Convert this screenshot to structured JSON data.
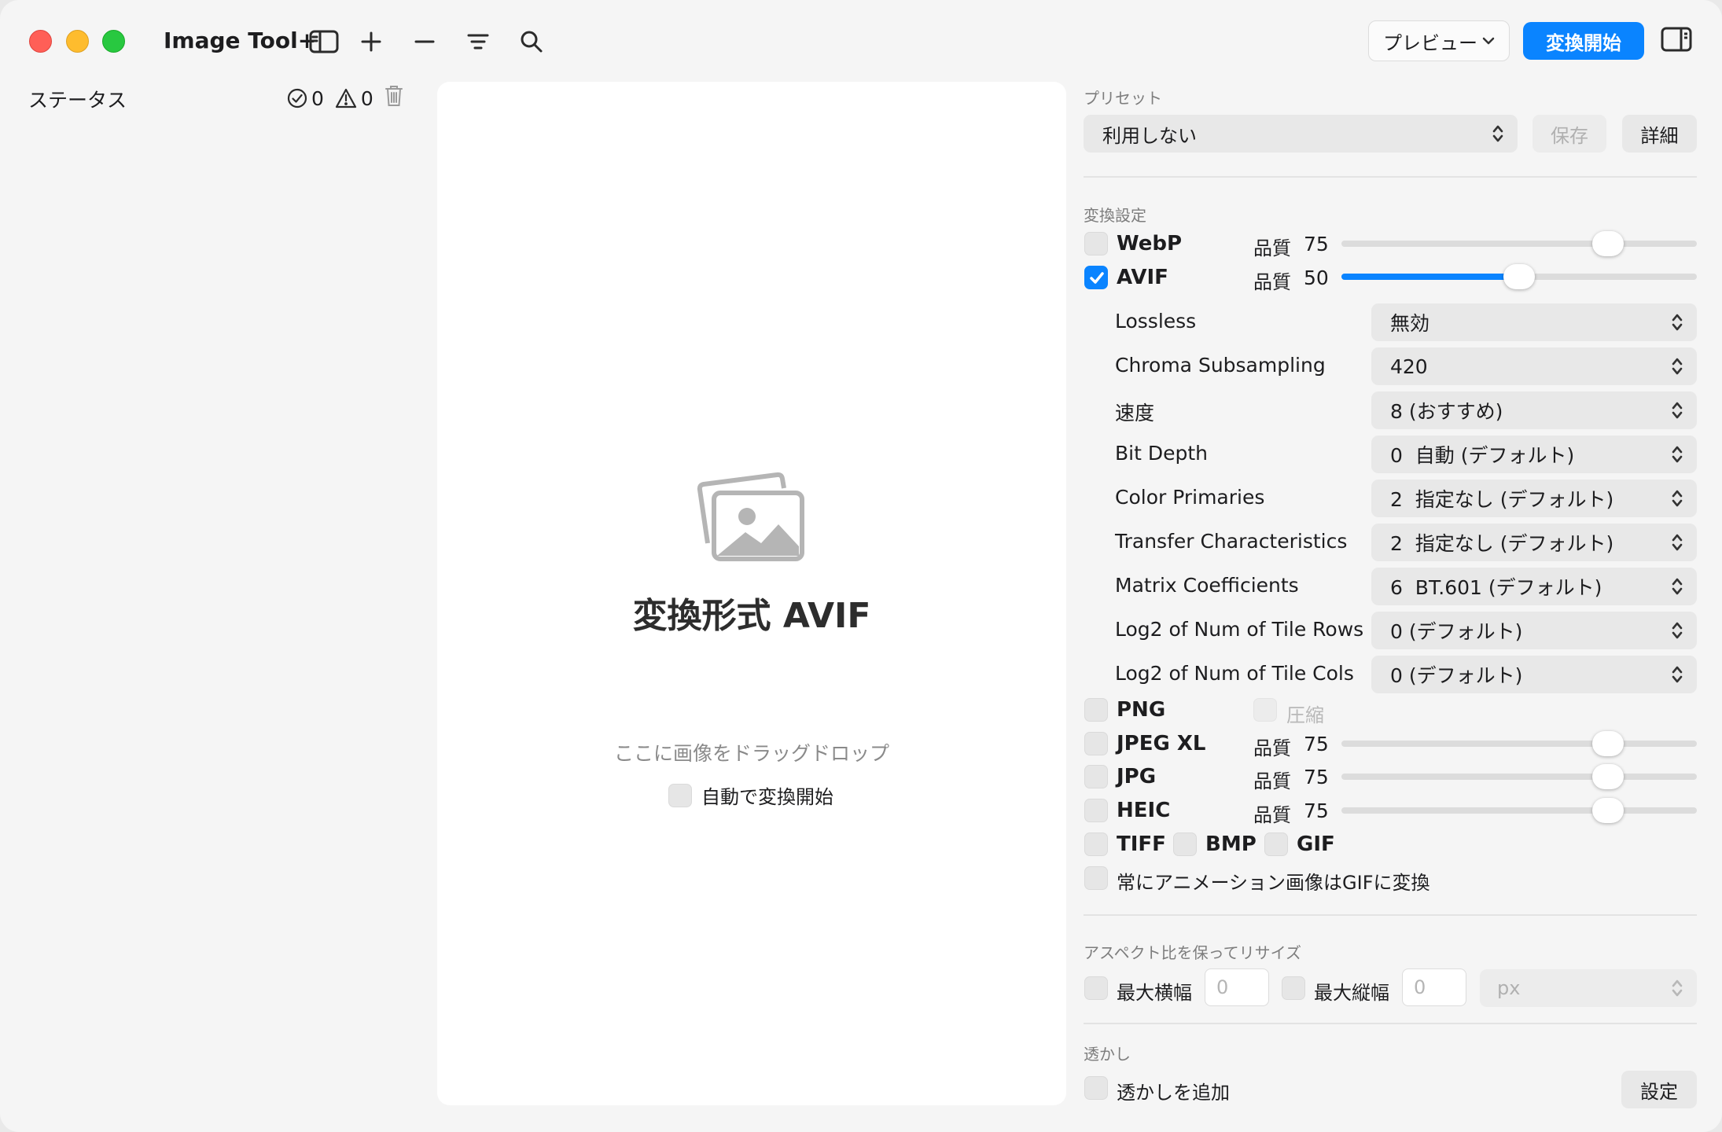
{
  "app": {
    "title": "Image Tool+"
  },
  "toolbar": {
    "preview_label": "プレビュー",
    "convert_label": "変換開始"
  },
  "sidebar": {
    "status_label": "ステータス",
    "success_count": "0",
    "warning_count": "0"
  },
  "drop": {
    "title": "変換形式 AVIF",
    "subtitle": "ここに画像をドラッグドロップ",
    "auto_start_label": "自動で変換開始"
  },
  "preset": {
    "section_label": "プリセット",
    "selected": "利用しない",
    "save_label": "保存",
    "details_label": "詳細"
  },
  "conversion": {
    "section_label": "変換設定",
    "quality_label": "品質",
    "webp": {
      "label": "WebP",
      "checked": false,
      "quality": "75",
      "quality_value": 75
    },
    "avif": {
      "label": "AVIF",
      "checked": true,
      "quality": "50",
      "quality_value": 50
    },
    "avif_options": [
      {
        "label": "Lossless",
        "value": "無効"
      },
      {
        "label": "Chroma Subsampling",
        "value": "420"
      },
      {
        "label": "速度",
        "value": "8 (おすすめ)"
      },
      {
        "label": "Bit Depth",
        "value": "0  自動 (デフォルト)"
      },
      {
        "label": "Color Primaries",
        "value": "2  指定なし (デフォルト)"
      },
      {
        "label": "Transfer Characteristics",
        "value": "2  指定なし (デフォルト)"
      },
      {
        "label": "Matrix Coefficients",
        "value": "6  BT.601 (デフォルト)"
      },
      {
        "label": "Log2 of Num of Tile Rows",
        "value": "0 (デフォルト)"
      },
      {
        "label": "Log2 of Num of Tile Cols",
        "value": "0 (デフォルト)"
      }
    ],
    "png": {
      "label": "PNG",
      "compress_label": "圧縮"
    },
    "jpegxl": {
      "label": "JPEG XL",
      "quality": "75",
      "quality_value": 75
    },
    "jpg": {
      "label": "JPG",
      "quality": "75",
      "quality_value": 75
    },
    "heic": {
      "label": "HEIC",
      "quality": "75",
      "quality_value": 75
    },
    "tiff": {
      "label": "TIFF"
    },
    "bmp": {
      "label": "BMP"
    },
    "gif": {
      "label": "GIF"
    },
    "animation_gif_label": "常にアニメーション画像はGIFに変換"
  },
  "resize": {
    "section_label": "アスペクト比を保ってリサイズ",
    "max_width_label": "最大横幅",
    "max_width_placeholder": "0",
    "max_height_label": "最大縦幅",
    "max_height_placeholder": "0",
    "unit": "px"
  },
  "watermark": {
    "section_label": "透かし",
    "add_label": "透かしを追加",
    "settings_label": "設定"
  }
}
